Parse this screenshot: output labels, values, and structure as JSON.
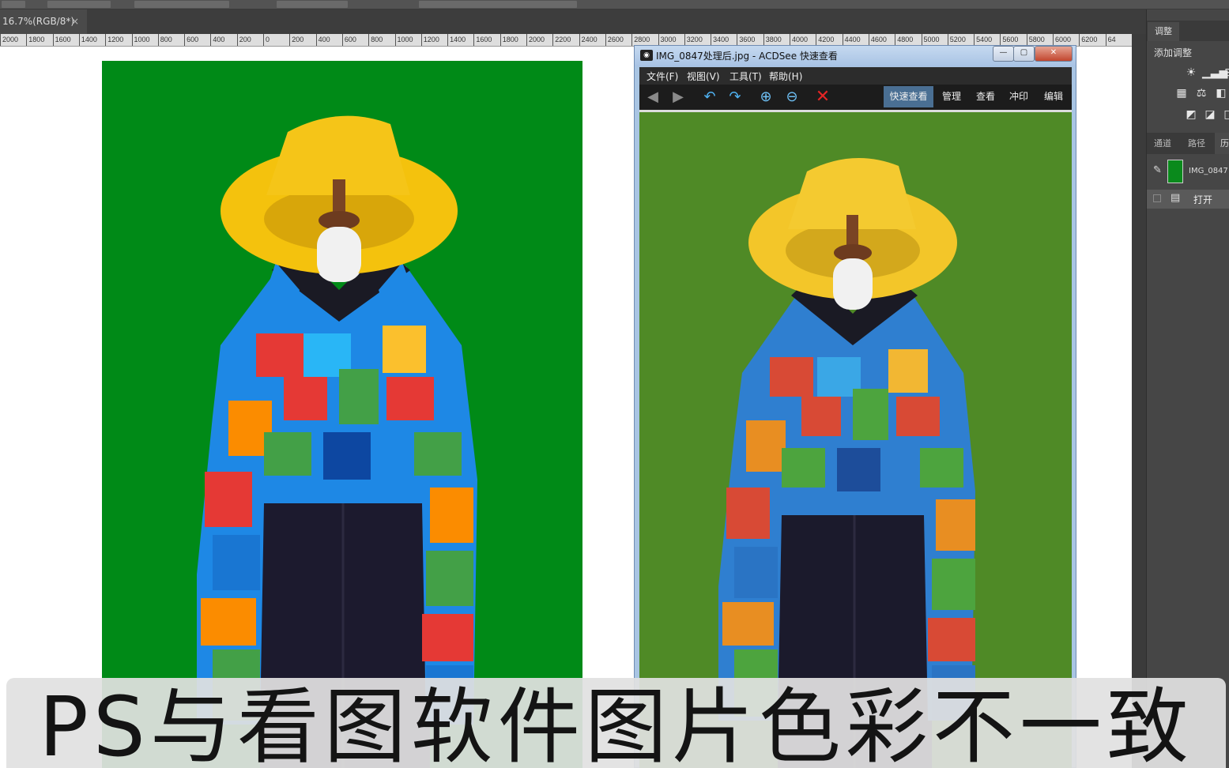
{
  "photoshop": {
    "doc_tab": {
      "label": "16.7%(RGB/8*)",
      "close": "×"
    },
    "ruler_ticks": [
      "2000",
      "1800",
      "1600",
      "1400",
      "1200",
      "1000",
      "800",
      "600",
      "400",
      "200",
      "0",
      "200",
      "400",
      "600",
      "800",
      "1000",
      "1200",
      "1400",
      "1600",
      "1800",
      "2000",
      "2200",
      "2400",
      "2600",
      "2800",
      "3000",
      "3200",
      "3400",
      "3600",
      "3800",
      "4000",
      "4200",
      "4400",
      "4600",
      "4800",
      "5000",
      "5200",
      "5400",
      "5600",
      "5800",
      "6000",
      "6200",
      "64"
    ],
    "adjustments": {
      "tab": "调整",
      "title": "添加调整",
      "icons": [
        "brightness-icon",
        "levels-icon",
        "curves-icon",
        "grid-icon",
        "balance-icon",
        "bw-icon",
        "invert-icon",
        "gradient-map-icon",
        "selective-icon"
      ]
    },
    "layer_tabs": [
      "通道",
      "路径",
      "历"
    ],
    "history": {
      "snapshot_label": "IMG_0847",
      "open_label": "打开"
    }
  },
  "acdsee": {
    "title": "IMG_0847处理后.jpg - ACDSee 快速查看",
    "window_buttons": {
      "minimize": "—",
      "maximize": "▢",
      "close": "✕"
    },
    "menu": [
      "文件(F)",
      "视图(V)",
      "工具(T)",
      "帮助(H)"
    ],
    "modes": [
      "快速查看",
      "管理",
      "查看",
      "冲印",
      "编辑"
    ],
    "colors": {
      "photo_bg": "#4f8a26"
    }
  },
  "left_photo": {
    "colors": {
      "bg": "#008a17"
    }
  },
  "caption": {
    "text": "PS与看图软件图片色彩不一致"
  }
}
